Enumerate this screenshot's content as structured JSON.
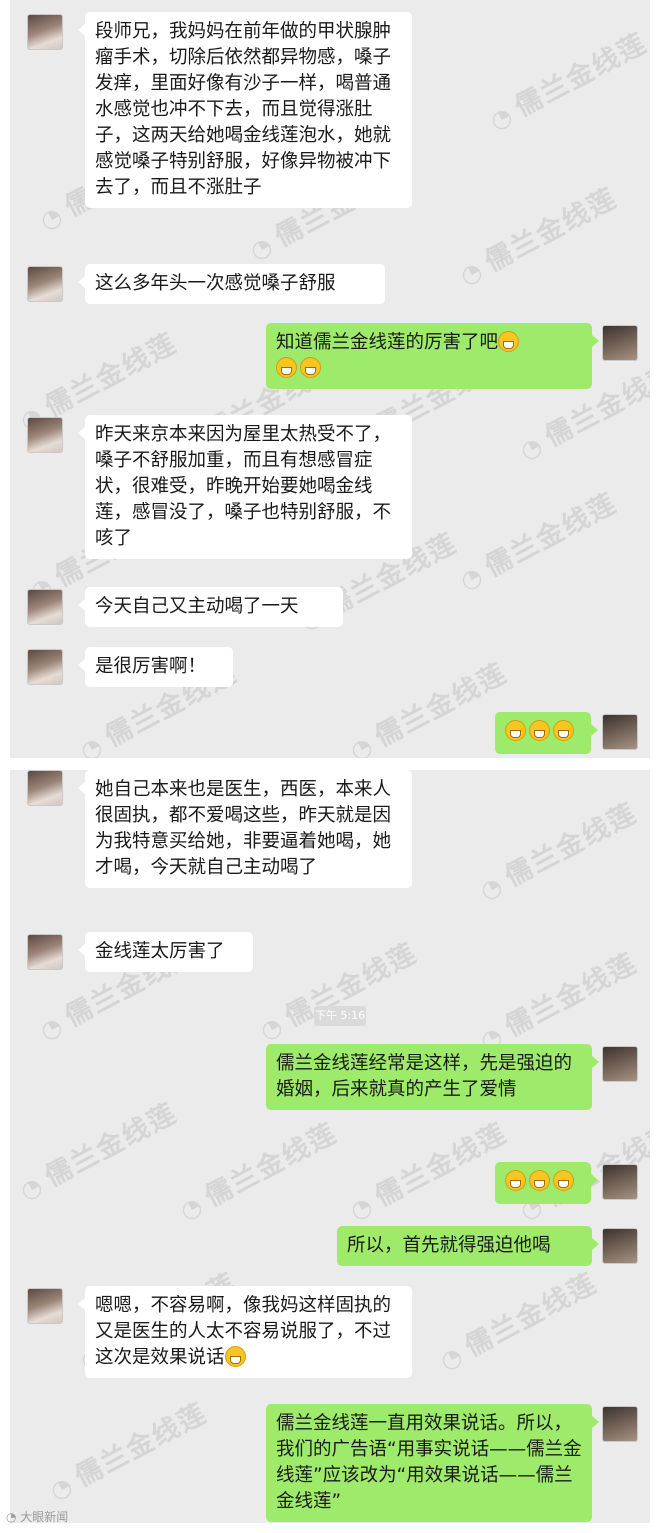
{
  "watermark": "儒兰金线莲",
  "footer_text": "大眼新闻",
  "timestamp": "下午 5:16",
  "panel1": [
    {
      "side": "in",
      "text": "段师兄，我妈妈在前年做的甲状腺肿瘤手术，切除后依然都异物感，嗓子发痒，里面好像有沙子一样，喝普通水感觉也冲不下去，而且觉得涨肚子，这两天给她喝金线莲泡水，她就感觉嗓子特别舒服，好像异物被冲下去了，而且不涨肚子"
    },
    {
      "side": "in",
      "text": "这么多年头一次感觉嗓子舒服"
    },
    {
      "side": "out",
      "text": "知道儒兰金线莲的厉害了吧"
    },
    {
      "side": "in",
      "text": "昨天来京本来因为屋里太热受不了，嗓子不舒服加重，而且有想感冒症状，很难受，昨晚开始要她喝金线莲，感冒没了，嗓子也特别舒服，不咳了"
    },
    {
      "side": "in",
      "text": "今天自己又主动喝了一天"
    },
    {
      "side": "in",
      "text": "是很厉害啊！"
    },
    {
      "side": "out",
      "text": ""
    }
  ],
  "panel2": [
    {
      "side": "in",
      "text": "她自己本来也是医生，西医，本来人很固执，都不爱喝这些，昨天就是因为我特意买给她，非要逼着她喝，她才喝，今天就自己主动喝了"
    },
    {
      "side": "in",
      "text": "金线莲太厉害了"
    },
    {
      "side": "out",
      "text": "儒兰金线莲经常是这样，先是强迫的婚姻，后来就真的产生了爱情"
    },
    {
      "side": "out",
      "text": ""
    },
    {
      "side": "out",
      "text": "所以，首先就得强迫他喝"
    },
    {
      "side": "in",
      "text": "嗯嗯，不容易啊，像我妈这样固执的又是医生的人太不容易说服了，不过这次是效果说话"
    },
    {
      "side": "out",
      "text": "儒兰金线莲一直用效果说话。所以，我们的广告语“用事实说话——儒兰金线莲”应该改为“用效果说话——儒兰金线莲”"
    }
  ]
}
